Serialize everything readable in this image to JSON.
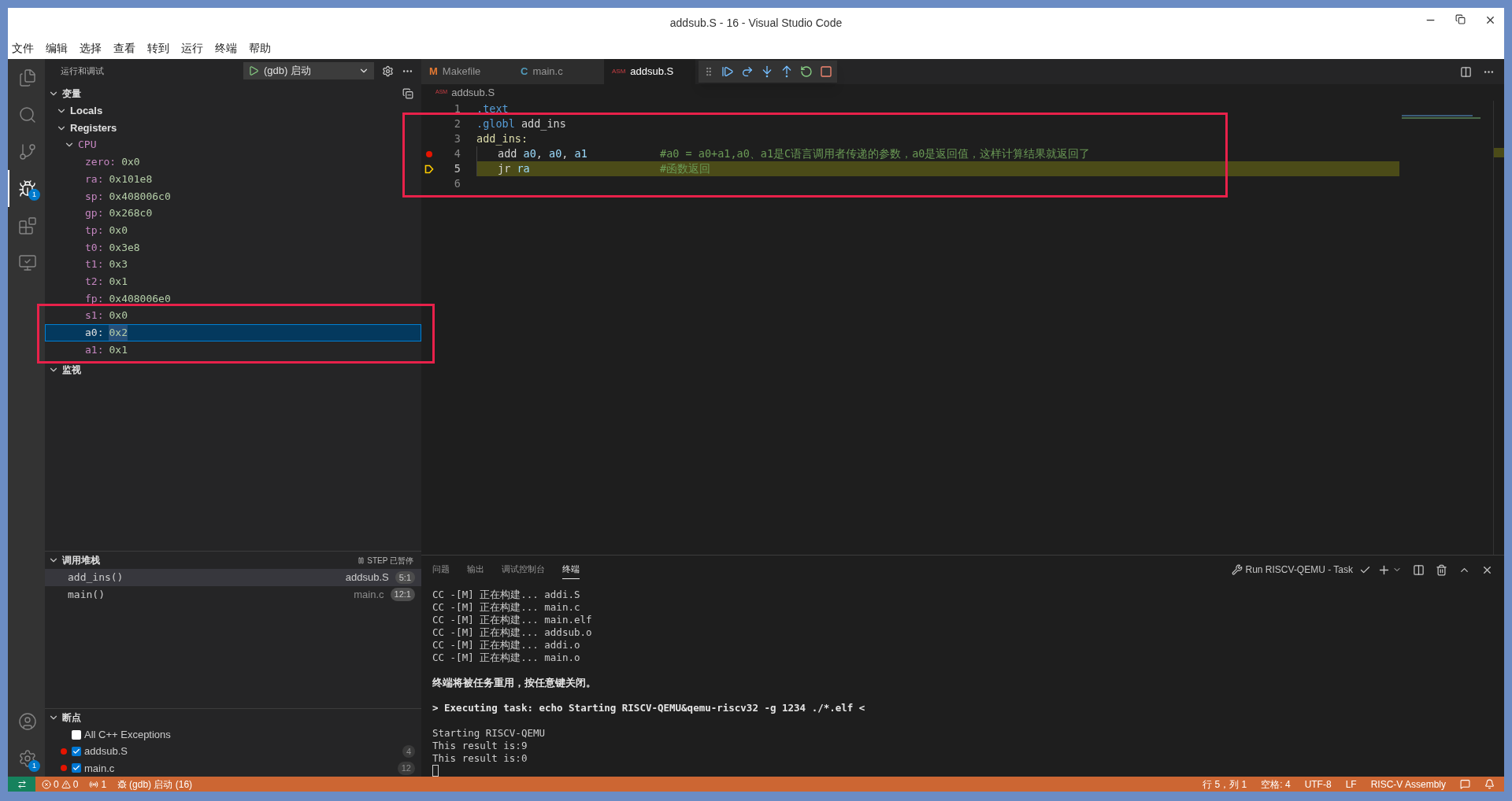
{
  "window": {
    "title": "addsub.S - 16 - Visual Studio Code"
  },
  "menu": [
    "文件",
    "编辑",
    "选择",
    "查看",
    "转到",
    "运行",
    "终端",
    "帮助"
  ],
  "activity_bar": {
    "top": [
      {
        "kind": "files",
        "selected": false
      },
      {
        "kind": "search",
        "selected": false
      },
      {
        "kind": "scm",
        "selected": false
      },
      {
        "kind": "debug",
        "selected": true,
        "badge": "1"
      },
      {
        "kind": "extensions",
        "selected": false
      },
      {
        "kind": "remote",
        "selected": false
      }
    ],
    "bottom": [
      {
        "kind": "account",
        "selected": false
      },
      {
        "kind": "settings",
        "selected": false,
        "badge": "1"
      }
    ]
  },
  "sidebar": {
    "title": "运行和调试",
    "launch_config": "(gdb) 启动",
    "variables": {
      "title": "变量",
      "expanded": true,
      "framed": true,
      "children": [
        {
          "label": "Locals",
          "expanded": true
        },
        {
          "label": "Registers",
          "expanded": true,
          "children": [
            {
              "label": "CPU",
              "expanded": true,
              "children": [
                {
                  "name": "zero:",
                  "value": "0x0",
                  "selected": false
                },
                {
                  "name": "ra:",
                  "value": "0x101e8",
                  "selected": false
                },
                {
                  "name": "sp:",
                  "value": "0x408006c0",
                  "selected": false
                },
                {
                  "name": "gp:",
                  "value": "0x268c0",
                  "selected": false
                },
                {
                  "name": "tp:",
                  "value": "0x0",
                  "selected": false
                },
                {
                  "name": "t0:",
                  "value": "0x3e8",
                  "selected": false
                },
                {
                  "name": "t1:",
                  "value": "0x3",
                  "selected": false
                },
                {
                  "name": "t2:",
                  "value": "0x1",
                  "selected": false
                },
                {
                  "name": "fp:",
                  "value": "0x408006e0",
                  "selected": false
                },
                {
                  "name": "s1:",
                  "value": "0x0",
                  "selected": false
                },
                {
                  "name": "a0:",
                  "value": "0x2",
                  "selected": true
                },
                {
                  "name": "a1:",
                  "value": "0x1",
                  "selected": false
                }
              ]
            }
          ]
        }
      ]
    },
    "watch": {
      "title": "监视",
      "expanded": true
    },
    "call_stack": {
      "title": "调用堆栈",
      "expanded": true,
      "status": "STEP 已暂停",
      "frames": [
        {
          "name": "add_ins()",
          "file": "addsub.S",
          "position": "5:1",
          "selected": true
        },
        {
          "name": "main()",
          "file": "main.c",
          "position": "12:1",
          "selected": false
        }
      ]
    },
    "breakpoints": {
      "title": "断点",
      "expanded": true,
      "items": [
        {
          "kind": "exception",
          "label": "All C++ Exceptions",
          "checked": false
        },
        {
          "kind": "file",
          "label": "addsub.S",
          "checked": true,
          "line": "4"
        },
        {
          "kind": "file",
          "label": "main.c",
          "checked": true,
          "line": "12"
        }
      ]
    }
  },
  "editor": {
    "tabs": [
      {
        "badge": "M",
        "kind": "make",
        "label": "Makefile",
        "selected": false
      },
      {
        "badge": "C",
        "kind": "c",
        "label": "main.c",
        "selected": false
      },
      {
        "badge": "ASM",
        "kind": "asm",
        "label": "addsub.S",
        "selected": true
      }
    ],
    "framed": true,
    "debug_toolbar": [
      {
        "kind": "continue"
      },
      {
        "kind": "step_over"
      },
      {
        "kind": "step_into"
      },
      {
        "kind": "step_out"
      },
      {
        "kind": "restart"
      },
      {
        "kind": "stop"
      }
    ],
    "breadcrumb": {
      "badge": "ASM",
      "label": "addsub.S"
    },
    "lines": [
      {
        "number": "1",
        "current": false,
        "indent": false,
        "tokens": [
          {
            "kind": "directive",
            "text": ".text"
          }
        ]
      },
      {
        "number": "2",
        "current": false,
        "indent": false,
        "tokens": [
          {
            "kind": "directive",
            "text": ".globl"
          },
          {
            "kind": "plain",
            "text": " add_ins"
          }
        ]
      },
      {
        "number": "3",
        "current": false,
        "indent": false,
        "tokens": [
          {
            "kind": "label",
            "text": "add_ins:"
          }
        ]
      },
      {
        "number": "4",
        "glyph": {
          "kind": "breakpoint"
        },
        "current": false,
        "indent": true,
        "tokens": [
          {
            "kind": "plain",
            "text": "add "
          },
          {
            "kind": "register",
            "text": "a0"
          },
          {
            "kind": "plain",
            "text": ", "
          },
          {
            "kind": "register",
            "text": "a0"
          },
          {
            "kind": "plain",
            "text": ", "
          },
          {
            "kind": "register",
            "text": "a1"
          }
        ],
        "comment": "#a0 = a0+a1,a0、a1是C语言调用者传递的参数，a0是返回值，这样计算结果就返回了"
      },
      {
        "number": "5",
        "glyph": {
          "kind": "current"
        },
        "current": true,
        "indent": true,
        "tokens": [
          {
            "kind": "plain",
            "text": "jr "
          },
          {
            "kind": "register",
            "text": "ra"
          }
        ],
        "comment": "#函数返回"
      },
      {
        "number": "6"
      }
    ]
  },
  "panel": {
    "tabs": [
      {
        "label": "问题",
        "selected": false
      },
      {
        "label": "输出",
        "selected": false
      },
      {
        "label": "调试控制台",
        "selected": false
      },
      {
        "label": "终端",
        "selected": true
      }
    ],
    "task": "Run RISCV-QEMU - Task",
    "terminal_blocks": [
      {
        "kind": "output",
        "lines": [
          "CC -[M] 正在构建... addi.S",
          "CC -[M] 正在构建... main.c",
          "CC -[M] 正在构建... main.elf",
          "CC -[M] 正在构建... addsub.o",
          "CC -[M] 正在构建... addi.o",
          "CC -[M] 正在构建... main.o"
        ]
      },
      {
        "kind": "notice",
        "lines": [
          "终端将被任务重用，按任意键关闭。"
        ]
      },
      {
        "kind": "notice",
        "lines": [
          "> Executing task: echo Starting RISCV-QEMU&qemu-riscv32 -g 1234 ./*.elf <"
        ]
      },
      {
        "kind": "output",
        "lines": [
          "Starting RISCV-QEMU",
          "This result is:9",
          "This result is:0"
        ]
      }
    ]
  },
  "status_bar": {
    "errors": "0",
    "warnings": "0",
    "ports": "1",
    "debug": "(gdb) 启动 (16)",
    "right": [
      "行 5，列 1",
      "空格: 4",
      "UTF-8",
      "LF",
      "RISC-V Assembly"
    ]
  }
}
